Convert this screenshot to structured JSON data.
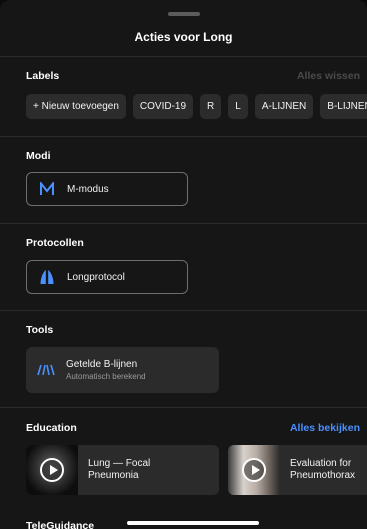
{
  "sheet": {
    "title": "Acties voor Long"
  },
  "labels": {
    "heading": "Labels",
    "clear_all": "Alles wissen",
    "chips": [
      "+ Nieuw toevoegen",
      "COVID-19",
      "R",
      "L",
      "A-LIJNEN",
      "B-LIJNEN"
    ]
  },
  "modes": {
    "heading": "Modi",
    "mmode_label": "M-modus"
  },
  "protocols": {
    "heading": "Protocollen",
    "lung_label": "Longprotocol"
  },
  "tools": {
    "heading": "Tools",
    "counted_title": "Getelde B-lijnen",
    "counted_subtitle": "Automatisch berekend"
  },
  "education": {
    "heading": "Education",
    "view_all": "Alles bekijken",
    "items": [
      {
        "line1": "Lung — Focal",
        "line2": "Pneumonia"
      },
      {
        "line1": "Evaluation for",
        "line2": "Pneumothorax"
      }
    ]
  },
  "teleguidance": {
    "heading": "TeleGuidance"
  },
  "colors": {
    "accent": "#4a90ff",
    "muted": "#4a4a4a",
    "sheet": "#161616"
  },
  "icons": [
    "m-mode-icon",
    "lung-icon",
    "b-lines-icon",
    "play-icon"
  ]
}
